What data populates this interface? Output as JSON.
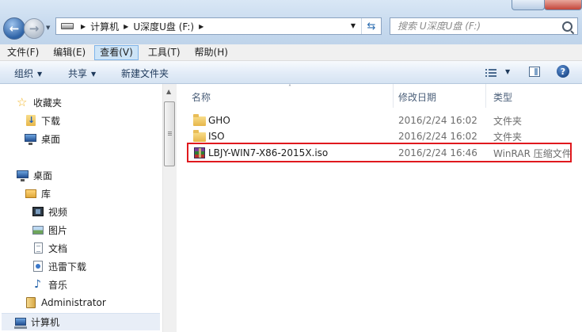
{
  "window": {
    "title": "U深度U盘 (F:)"
  },
  "address": {
    "breadcrumbs": [
      "计算机",
      "U深度U盘 (F:)"
    ],
    "search_placeholder": "搜索 U深度U盘 (F:)"
  },
  "menu": {
    "items": [
      "文件(F)",
      "编辑(E)",
      "查看(V)",
      "工具(T)",
      "帮助(H)"
    ],
    "active_index": 2
  },
  "toolbar": {
    "organize_label": "组织",
    "share_label": "共享",
    "new_folder_label": "新建文件夹"
  },
  "nav": {
    "favorites": "收藏夹",
    "downloads": "下载",
    "desktop_fav": "桌面",
    "desktop_root": "桌面",
    "libraries": "库",
    "videos": "视频",
    "pictures": "图片",
    "documents": "文档",
    "thunder": "迅雷下载",
    "music": "音乐",
    "administrator": "Administrator",
    "computer": "计算机"
  },
  "columns": {
    "name": "名称",
    "date": "修改日期",
    "type": "类型"
  },
  "files": [
    {
      "name": "GHO",
      "date": "2016/2/24 16:02",
      "type": "文件夹",
      "icon": "folder-icon"
    },
    {
      "name": "ISO",
      "date": "2016/2/24 16:02",
      "type": "文件夹",
      "icon": "folder-icon"
    },
    {
      "name": "LBJY-WIN7-X86-2015X.iso",
      "date": "2016/2/24 16:46",
      "type": "WinRAR 压缩文件",
      "icon": "winrar-archive-icon",
      "highlighted": true
    }
  ],
  "colors": {
    "highlight_border": "#e0191e",
    "accent": "#1e395b"
  }
}
